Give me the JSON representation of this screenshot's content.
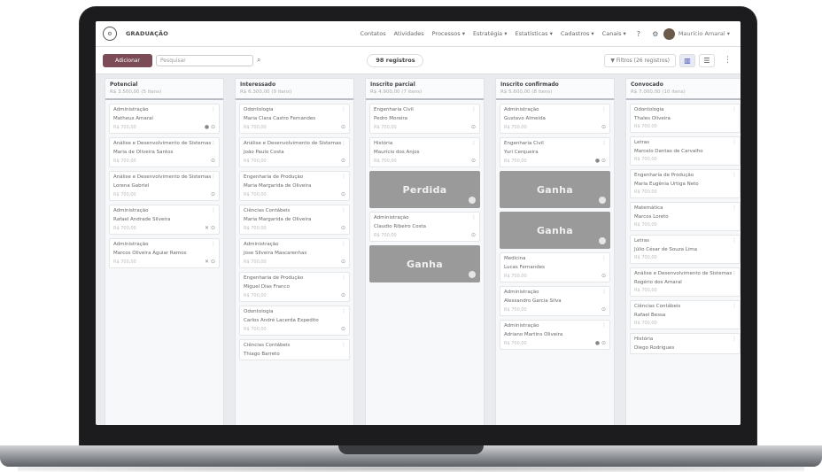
{
  "topnav": {
    "logo_glyph": "⚙",
    "brand": "GRADUAÇÃO",
    "links": [
      "Contatos",
      "Atividades",
      "Processos ▾",
      "Estratégia ▾",
      "Estatísticas ▾",
      "Cadastros ▾",
      "Canais ▾"
    ],
    "user": "Maurício Amaral ▾"
  },
  "toolbar": {
    "add_label": "Adicionar",
    "search_placeholder": "Pesquisar",
    "records": "98 registros",
    "filters": "▼ Filtros (26 registros)"
  },
  "columns": [
    {
      "name": "Potencial",
      "total": "R$ 3.500,00 (5 itens)",
      "items": [
        {
          "title": "Administração",
          "name": "Matheus Amaral",
          "meta": "R$ 700,00",
          "icons": "● ⊙"
        },
        {
          "title": "Análise e Desenvolvimento de Sistemas",
          "name": "Maria de Oliveira Santos",
          "meta": "R$ 700,00",
          "icons": "⊙"
        },
        {
          "title": "Análise e Desenvolvimento de Sistemas",
          "name": "Lorena Gabriel",
          "meta": "R$ 700,00",
          "icons": "⊙"
        },
        {
          "title": "Administração",
          "name": "Rafael Andrade Silveira",
          "meta": "R$ 700,00",
          "icons": "✕ ⊙"
        },
        {
          "title": "Administração",
          "name": "Marcos Oliveira Aguiar Ramos",
          "meta": "R$ 700,00",
          "icons": "✕ ⊙"
        }
      ]
    },
    {
      "name": "Interessado",
      "total": "R$ 6.300,00 (9 itens)",
      "items": [
        {
          "title": "Odontologia",
          "name": "Maria Clara Castro Fernandes",
          "meta": "R$ 700,00",
          "icons": "⊙"
        },
        {
          "title": "Análise e Desenvolvimento de Sistemas",
          "name": "João Paulo Costa",
          "meta": "R$ 700,00",
          "icons": "⊙"
        },
        {
          "title": "Engenharia de Produção",
          "name": "Maria Margarida de Oliveira",
          "meta": "R$ 700,00",
          "icons": "⊙"
        },
        {
          "title": "Ciências Contábeis",
          "name": "Maria Margarida de Oliveira",
          "meta": "R$ 700,00",
          "icons": "⊙"
        },
        {
          "title": "Administração",
          "name": "Jose Silveira Mascarenhas",
          "meta": "R$ 700,00",
          "icons": "⊙"
        },
        {
          "title": "Engenharia de Produção",
          "name": "Miguel Dias Franco",
          "meta": "R$ 700,00",
          "icons": "⊙"
        },
        {
          "title": "Odontologia",
          "name": "Carlos André Lacerda Expedito",
          "meta": "R$ 700,00",
          "icons": "⊙"
        },
        {
          "title": "Ciências Contábeis",
          "name": "Thiago Barreto",
          "meta": "",
          "icons": ""
        }
      ]
    },
    {
      "name": "Inscrito parcial",
      "total": "R$ 4.900,00 (7 itens)",
      "items": [
        {
          "title": "Engenharia Civil",
          "name": "Pedro Moreira",
          "meta": "R$ 700,00",
          "icons": "⊙"
        },
        {
          "title": "História",
          "name": "Maurício dos Anjos",
          "meta": "R$ 700,00",
          "icons": "⊙"
        }
      ],
      "drop1": "Perdida",
      "items2": [
        {
          "title": "Administração",
          "name": "Claudio Ribeiro Costa",
          "meta": "R$ 700,00",
          "icons": "⊙"
        }
      ],
      "drop2": "Ganha"
    },
    {
      "name": "Inscrito confirmado",
      "total": "R$ 5.600,00 (8 itens)",
      "items": [
        {
          "title": "Administração",
          "name": "Gustavo Almeida",
          "meta": "R$ 700,00",
          "icons": "⊙"
        },
        {
          "title": "Engenharia Civil",
          "name": "Yuri Cerqueira",
          "meta": "R$ 700,00",
          "icons": "● ⊙"
        }
      ],
      "drop1": "Ganha",
      "drop2": "Ganha",
      "items2": [
        {
          "title": "Medicina",
          "name": "Lucas Fernandes",
          "meta": "R$ 700,00",
          "icons": "⊙"
        },
        {
          "title": "Administração",
          "name": "Alessandro Garcia Silva",
          "meta": "R$ 700,00",
          "icons": "⊙"
        },
        {
          "title": "Administração",
          "name": "Adriano Martins Oliveira",
          "meta": "R$ 700,00",
          "icons": "● ⊙"
        }
      ]
    },
    {
      "name": "Convocado",
      "total": "R$ 7.000,00 (10 itens)",
      "items": [
        {
          "title": "Odontologia",
          "name": "Thales Oliveira",
          "meta": "R$ 700,00",
          "icons": ""
        },
        {
          "title": "Letras",
          "name": "Marcelo Dantas de Carvalho",
          "meta": "R$ 700,00",
          "icons": ""
        },
        {
          "title": "Engenharia de Produção",
          "name": "Maria Eugênia Urtiga Neto",
          "meta": "R$ 700,00",
          "icons": ""
        },
        {
          "title": "Matemática",
          "name": "Marcos Loreto",
          "meta": "R$ 700,00",
          "icons": ""
        },
        {
          "title": "Letras",
          "name": "Júlio César de Souza Lima",
          "meta": "R$ 700,00",
          "icons": ""
        },
        {
          "title": "Análise e Desenvolvimento de Sistemas",
          "name": "Rogério dos Amaral",
          "meta": "R$ 700,00",
          "icons": ""
        },
        {
          "title": "Ciências Contábeis",
          "name": "Rafael Bessa",
          "meta": "R$ 700,00",
          "icons": ""
        },
        {
          "title": "História",
          "name": "Diego Rodrigues",
          "meta": "",
          "icons": ""
        }
      ]
    }
  ]
}
